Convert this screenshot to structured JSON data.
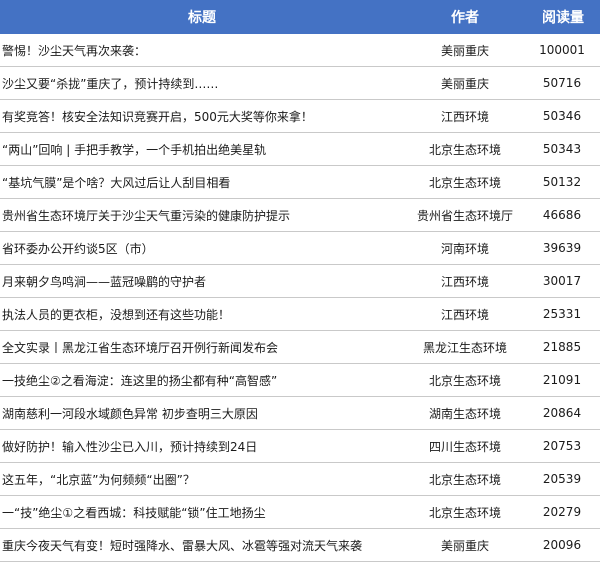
{
  "header": {
    "title": "标题",
    "author": "作者",
    "reads": "阅读量"
  },
  "rows": [
    {
      "title": "警惕！沙尘天气再次来袭：",
      "author": "美丽重庆",
      "reads": "100001"
    },
    {
      "title": "沙尘又要“杀拢”重庆了，预计持续到……",
      "author": "美丽重庆",
      "reads": "50716"
    },
    {
      "title": "有奖竞答！核安全法知识竞赛开启，500元大奖等你来拿！",
      "author": "江西环境",
      "reads": "50346"
    },
    {
      "title": "“两山”回响 | 手把手教学，一个手机拍出绝美星轨",
      "author": "北京生态环境",
      "reads": "50343"
    },
    {
      "title": "“基坑气膜”是个啥？大风过后让人刮目相看",
      "author": "北京生态环境",
      "reads": "50132"
    },
    {
      "title": "贵州省生态环境厅关于沙尘天气重污染的健康防护提示",
      "author": "贵州省生态环境厅",
      "reads": "46686"
    },
    {
      "title": "省环委办公开约谈5区（市）",
      "author": "河南环境",
      "reads": "39639"
    },
    {
      "title": "月来朝夕鸟鸣涧——蓝冠噪鹛的守护者",
      "author": "江西环境",
      "reads": "30017"
    },
    {
      "title": "执法人员的更衣柜，没想到还有这些功能！",
      "author": "江西环境",
      "reads": "25331"
    },
    {
      "title": "全文实录丨黑龙江省生态环境厅召开例行新闻发布会",
      "author": "黑龙江生态环境",
      "reads": "21885"
    },
    {
      "title": "一技绝尘②之看海淀：连这里的扬尘都有种“高智感”",
      "author": "北京生态环境",
      "reads": "21091"
    },
    {
      "title": "湖南慈利一河段水域颜色异常 初步查明三大原因",
      "author": "湖南生态环境",
      "reads": "20864"
    },
    {
      "title": "做好防护！输入性沙尘已入川，预计持续到24日",
      "author": "四川生态环境",
      "reads": "20753"
    },
    {
      "title": "这五年，“北京蓝”为何频频“出圈”？",
      "author": "北京生态环境",
      "reads": "20539"
    },
    {
      "title": "一“技”绝尘①之看西城：科技赋能“锁”住工地扬尘",
      "author": "北京生态环境",
      "reads": "20279"
    },
    {
      "title": "重庆今夜天气有变！短时强降水、雷暴大风、冰雹等强对流天气来袭",
      "author": "美丽重庆",
      "reads": "20096"
    }
  ]
}
